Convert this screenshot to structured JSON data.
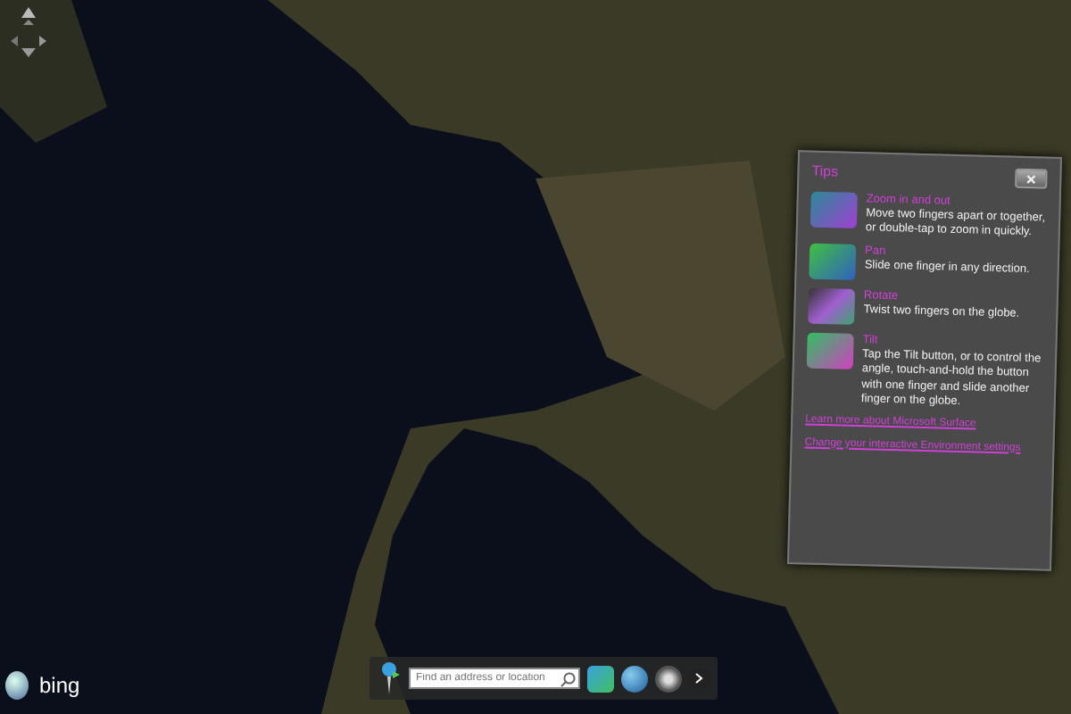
{
  "tips_panel": {
    "title": "Tips",
    "tips": [
      {
        "heading": "Zoom in and out",
        "text": "Move two fingers apart or together, or double-tap to zoom in quickly."
      },
      {
        "heading": "Pan",
        "text": "Slide one finger in any direction."
      },
      {
        "heading": "Rotate",
        "text": "Twist two fingers on the globe."
      },
      {
        "heading": "Tilt",
        "text": "Tap the Tilt button, or to control the angle, touch-and-hold the button with one finger and slide another finger on the globe."
      }
    ],
    "links": [
      "Learn more about Microsoft Surface",
      "Change your interactive Environment settings"
    ]
  },
  "search": {
    "placeholder": "Find an address or location"
  },
  "brand": "bing"
}
